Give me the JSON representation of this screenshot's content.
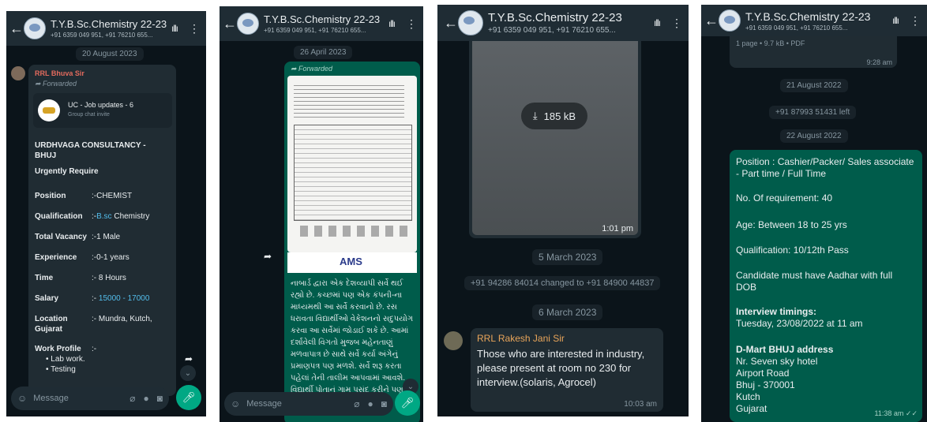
{
  "chat": {
    "title": "T.Y.B.Sc.Chemistry 22-23",
    "subtitle": "+91 6359 049 951, +91 76210 655...",
    "input_placeholder": "Message"
  },
  "p1": {
    "date_chip": "20 August 2023",
    "sender": "RRL Bhuva Sir",
    "forwarded": "Forwarded",
    "invite_title": "UC - Job updates - 6",
    "invite_sub": "Group chat invite",
    "company": "URDHVAGA CONSULTANCY - BHUJ",
    "urgent": "Urgently Require",
    "rows": [
      {
        "k": "Position",
        "v": ":-CHEMIST"
      },
      {
        "k": "Qualification",
        "v1": ":-",
        "v2": "B.sc",
        "v3": " Chemistry"
      },
      {
        "k": "Total Vacancy",
        "v": ":-1 Male"
      },
      {
        "k": "Experience",
        "v": ":-0-1 years"
      },
      {
        "k": "Time",
        "v": ":- 8 Hours"
      },
      {
        "k": "Salary",
        "v1": ":- ",
        "v2": "15000 - 17000"
      },
      {
        "k": "Location",
        "v": ":- Mundra, Kutch,"
      },
      {
        "k": "Gujarat",
        "v": ""
      }
    ],
    "work_profile": "Work Profile",
    "work_profile_sep": ":-",
    "bullets": [
      "Lab work.",
      "Testing"
    ]
  },
  "p2": {
    "date_chip": "26 April 2023",
    "forwarded": "Forwarded",
    "doc_brand": "AMS",
    "text": "નાબાર્ડ દ્વારા એક દેશવ્યાપી સર્વે થઈ રહ્યો છે. કચ્છમાં પણ એક કંપની-ના માધ્યમથી આ સર્વે કરવાનો છે. રસ ધરાવતા વિદ્યાર્થીઓ વેકેશનનો સદુપયોગ કરવા આ સર્વેમાં જોડાઈ શકે છે. આમાં દર્શાવેલી વિગતો મુજબ મહેનતાણું મળવાપાત્ર છે સાથે સર્વે કર્યા અંગેનું પ્રમાણપત્ર પણ મળશે. સર્વે શરૂ કરતા પહેલાં તેની તાલીમ આપવામાં આવશે. વિદ્યાર્થી પોતાનું ગામ પસંદ કરીને પણ આ સર્વે કરી શકશે. જોડાવા"
  },
  "p3": {
    "file_size": "185 kB",
    "img_time": "1:01 pm",
    "date_chip1": "5 March 2023",
    "system_msg": "+91 94286 84014 changed to +91 84900 44837",
    "date_chip2": "6 March 2023",
    "sender": "RRL Rakesh Jani Sir",
    "message": "Those who are interested in industry, please present at room no 230 for interview.(solaris, Agrocel)",
    "time": "10:03 am"
  },
  "p4": {
    "doc_meta": "1 page • 9.7 kB • PDF",
    "doc_time": "9:28 am",
    "date_chip1": "21 August 2022",
    "left_msg": "+91 87993 51431 left",
    "date_chip2": "22 August 2022",
    "lines": [
      "Position : Cashier/Packer/ Sales associate - Part time / Full Time",
      "No. Of requirement: 40",
      "Age: Between 18 to 25 yrs",
      "Qualification: 10/12th Pass",
      "Candidate must have Aadhar with full DOB"
    ],
    "interview_head": "Interview timings:",
    "interview_val": "Tuesday, 23/08/2022 at 11 am",
    "addr_head": "D-Mart BHUJ address",
    "addr_lines": [
      "Nr. Seven sky hotel",
      "Airport Road",
      "Bhuj - 370001",
      "Kutch",
      "Gujarat"
    ],
    "time": "11:38 am"
  }
}
